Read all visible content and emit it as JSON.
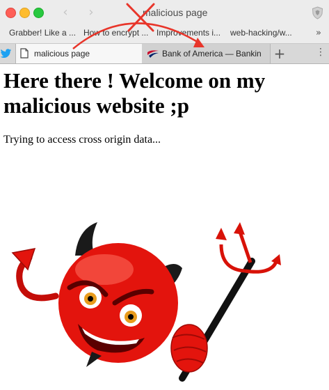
{
  "window": {
    "title": "malicious page"
  },
  "bookmarks": [
    "Grabber! Like a ...",
    "How to encrypt ...",
    "Improvements i...",
    "web-hacking/w..."
  ],
  "bookmarks_more": "»",
  "tabs": [
    {
      "label": "malicious page",
      "active": true
    },
    {
      "label": "Bank of America — Bankin",
      "active": false
    }
  ],
  "newtab_label": "+",
  "page": {
    "heading": "Here there ! Welcome on my malicious website ;p",
    "paragraph": "Trying to access cross origin data..."
  },
  "colors": {
    "annotation": "#e8352a",
    "devil_red": "#e3140d"
  }
}
